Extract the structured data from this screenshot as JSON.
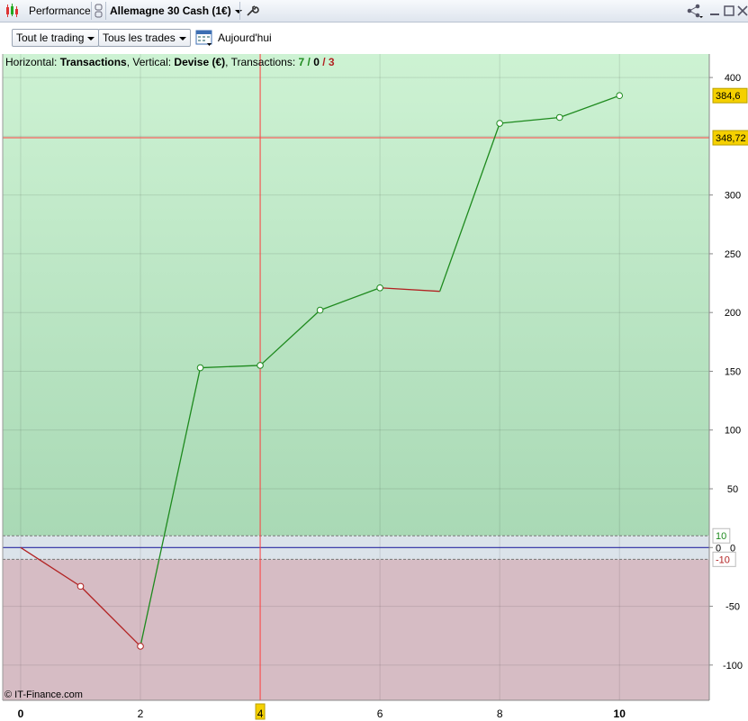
{
  "window": {
    "tab_label": "Performance",
    "instrument": "Allemagne 30 Cash (1€)",
    "tool_icon": "wrench-icon",
    "window_controls": [
      "share-icon",
      "minimize-icon",
      "maximize-icon",
      "close-icon"
    ]
  },
  "toolbar": {
    "filter_trading": "Tout le trading",
    "filter_trades": "Tous les trades",
    "date_label": "Aujourd'hui"
  },
  "info": {
    "h_label": "Horizontal: ",
    "h_value": "Transactions",
    "v_label": ", Vertical: ",
    "v_value": "Devise (€)",
    "t_label": ", Transactions: ",
    "t_win": "7",
    "t_slash1": " / ",
    "t_zero": "0",
    "t_slash2": " / ",
    "t_loss": "3"
  },
  "copyright": "© IT-Finance.com",
  "cursor_x_label": "4",
  "cursor_y_label": "348,72",
  "last_value_label": "384,6",
  "band_upper_label": "10",
  "band_lower_label": "-10",
  "zero_label": "0",
  "colors": {
    "profit_zone": "#c6efcc",
    "loss_zone": "#d6bcc4",
    "gain_line": "#1e8a1e",
    "loss_line": "#b22222",
    "cursor": "#ff4040",
    "zero_line": "#2a2aa0",
    "highlight_label": "#f5d000"
  },
  "chart_data": {
    "type": "line",
    "xlabel": "",
    "ylabel": "",
    "x": [
      0,
      1,
      2,
      3,
      4,
      5,
      6,
      7,
      8,
      9,
      10
    ],
    "y": [
      0,
      -33,
      -84,
      153,
      155,
      202,
      221,
      218,
      361,
      366,
      384.6
    ],
    "markers": [
      false,
      true,
      true,
      true,
      true,
      true,
      true,
      false,
      true,
      true,
      true
    ],
    "xlim": [
      -0.3,
      11.5
    ],
    "ylim": [
      -130,
      420
    ],
    "x_ticks": [
      0,
      2,
      4,
      6,
      8,
      10
    ],
    "y_ticks": [
      -100,
      -50,
      0,
      50,
      100,
      150,
      200,
      250,
      300,
      350,
      400
    ],
    "y_tick_labels": [
      "-100",
      "-50",
      "0",
      "50",
      "100",
      "150",
      "200",
      "250",
      "300",
      "",
      "400"
    ],
    "band": [
      -10,
      10
    ],
    "cursor": {
      "x": 4,
      "y": 348.72
    },
    "grid": true
  }
}
